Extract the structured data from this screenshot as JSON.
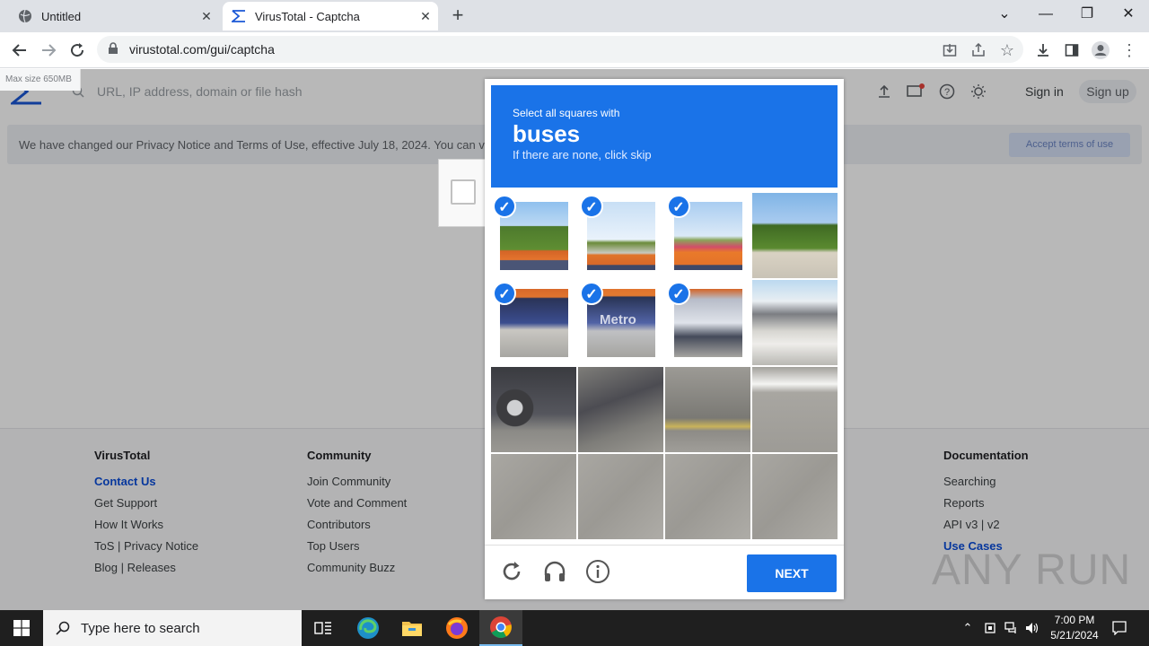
{
  "browser": {
    "tabs": [
      {
        "title": "Untitled",
        "active": false
      },
      {
        "title": "VirusTotal - Captcha",
        "active": true
      }
    ],
    "url": "virustotal.com/gui/captcha"
  },
  "page": {
    "maxsize_label": "Max size 650MB",
    "search_placeholder": "URL, IP address, domain or file hash",
    "sign_in": "Sign in",
    "sign_up": "Sign up",
    "notice_text": "We have changed our Privacy Notice and Terms of Use, effective July 18, 2024. You can v",
    "accept_button": "Accept terms of use"
  },
  "footer": {
    "virustotal": {
      "heading": "VirusTotal",
      "items": [
        "Contact Us",
        "Get Support",
        "How It Works",
        "ToS | Privacy Notice",
        "Blog | Releases"
      ]
    },
    "community": {
      "heading": "Community",
      "items": [
        "Join Community",
        "Vote and Comment",
        "Contributors",
        "Top Users",
        "Community Buzz"
      ]
    },
    "documentation": {
      "heading": "Documentation",
      "items": [
        "Searching",
        "Reports",
        "API v3 | v2",
        "Use Cases"
      ]
    }
  },
  "captcha": {
    "instruction_small": "Select all squares with",
    "target": "buses",
    "hint": "If there are none, click skip",
    "next_button": "NEXT",
    "tiles": [
      {
        "selected": true,
        "scene": "tree-bus-top"
      },
      {
        "selected": true,
        "scene": "sky-bus-top"
      },
      {
        "selected": true,
        "scene": "sky-bus-top-sign"
      },
      {
        "selected": false,
        "scene": "trees-pole"
      },
      {
        "selected": true,
        "scene": "bus-windows"
      },
      {
        "selected": true,
        "scene": "bus-metro",
        "text": "Metro"
      },
      {
        "selected": true,
        "scene": "bus-front"
      },
      {
        "selected": false,
        "scene": "fence-road"
      },
      {
        "selected": false,
        "scene": "truck-wheel"
      },
      {
        "selected": false,
        "scene": "road-shadow"
      },
      {
        "selected": false,
        "scene": "road-yellow-line"
      },
      {
        "selected": false,
        "scene": "road-marking"
      },
      {
        "selected": false,
        "scene": "road"
      },
      {
        "selected": false,
        "scene": "road"
      },
      {
        "selected": false,
        "scene": "road"
      },
      {
        "selected": false,
        "scene": "road"
      }
    ]
  },
  "watermark": "ANY RUN",
  "taskbar": {
    "search_placeholder": "Type here to search",
    "time": "7:00 PM",
    "date": "5/21/2024"
  }
}
